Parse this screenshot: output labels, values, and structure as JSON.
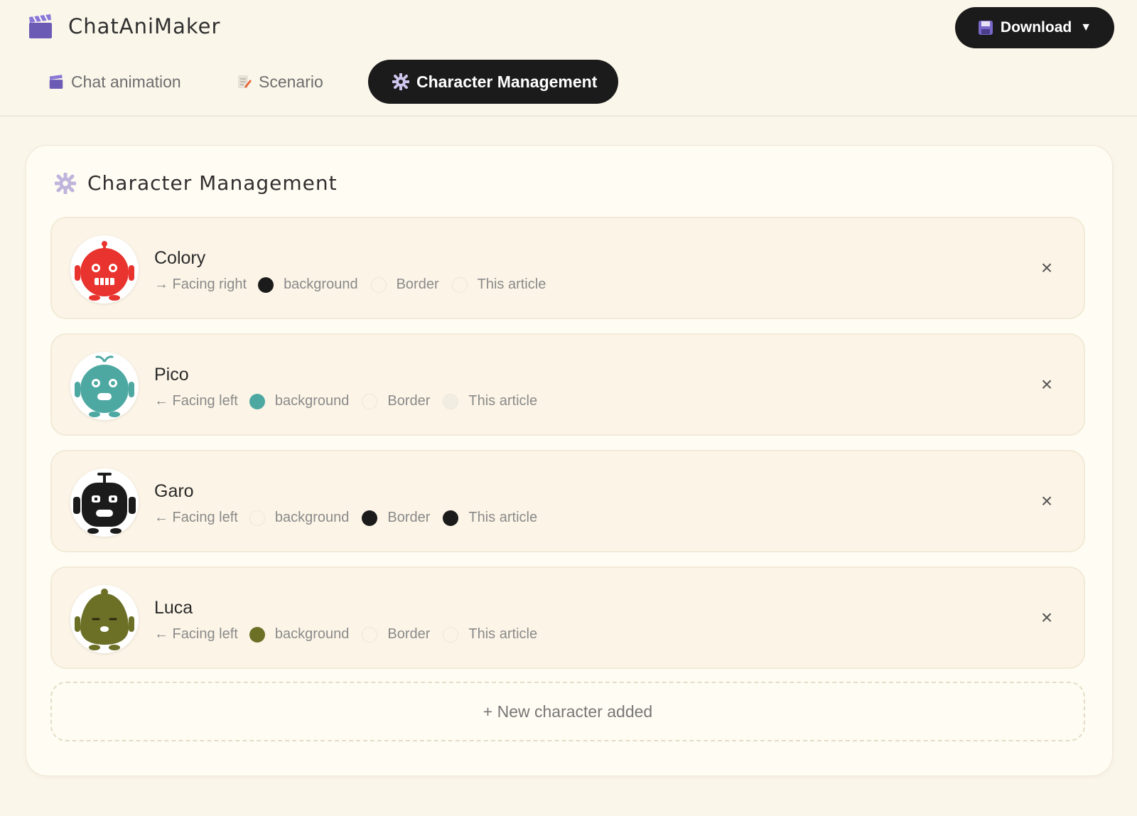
{
  "app": {
    "title": "ChatAniMaker",
    "icon": "clapperboard-icon"
  },
  "download": {
    "label": "Download",
    "icon": "floppy-disk-icon",
    "caret": "▼"
  },
  "tabs": [
    {
      "label": "Chat animation",
      "icon": "clapperboard-icon",
      "active": false
    },
    {
      "label": "Scenario",
      "icon": "memo-icon",
      "active": false
    },
    {
      "label": "Character Management",
      "icon": "gear-icon",
      "active": true
    }
  ],
  "panel": {
    "title": "Character Management",
    "icon": "gear-icon"
  },
  "characters": [
    {
      "name": "Colory",
      "facing": "→ Facing right",
      "avatar_color": "#e8332e",
      "background_color": "#1b1b1b",
      "border_color": "",
      "text_color": "",
      "labels": {
        "background": "background",
        "border": "Border",
        "text": "This article"
      }
    },
    {
      "name": "Pico",
      "facing": "← Facing left",
      "avatar_color": "#4ea8a2",
      "background_color": "#4ea8a2",
      "border_color": "",
      "text_color": "#f1ede2",
      "labels": {
        "background": "background",
        "border": "Border",
        "text": "This article"
      }
    },
    {
      "name": "Garo",
      "facing": "← Facing left",
      "avatar_color": "#1b1b1b",
      "background_color": "",
      "border_color": "#1b1b1b",
      "text_color": "#1b1b1b",
      "labels": {
        "background": "background",
        "border": "Border",
        "text": "This article"
      }
    },
    {
      "name": "Luca",
      "facing": "← Facing left",
      "avatar_color": "#6b7026",
      "background_color": "#6b7026",
      "border_color": "",
      "text_color": "",
      "labels": {
        "background": "background",
        "border": "Border",
        "text": "This article"
      }
    }
  ],
  "close_glyph": "×",
  "add_button": {
    "label": "+ New character added"
  }
}
